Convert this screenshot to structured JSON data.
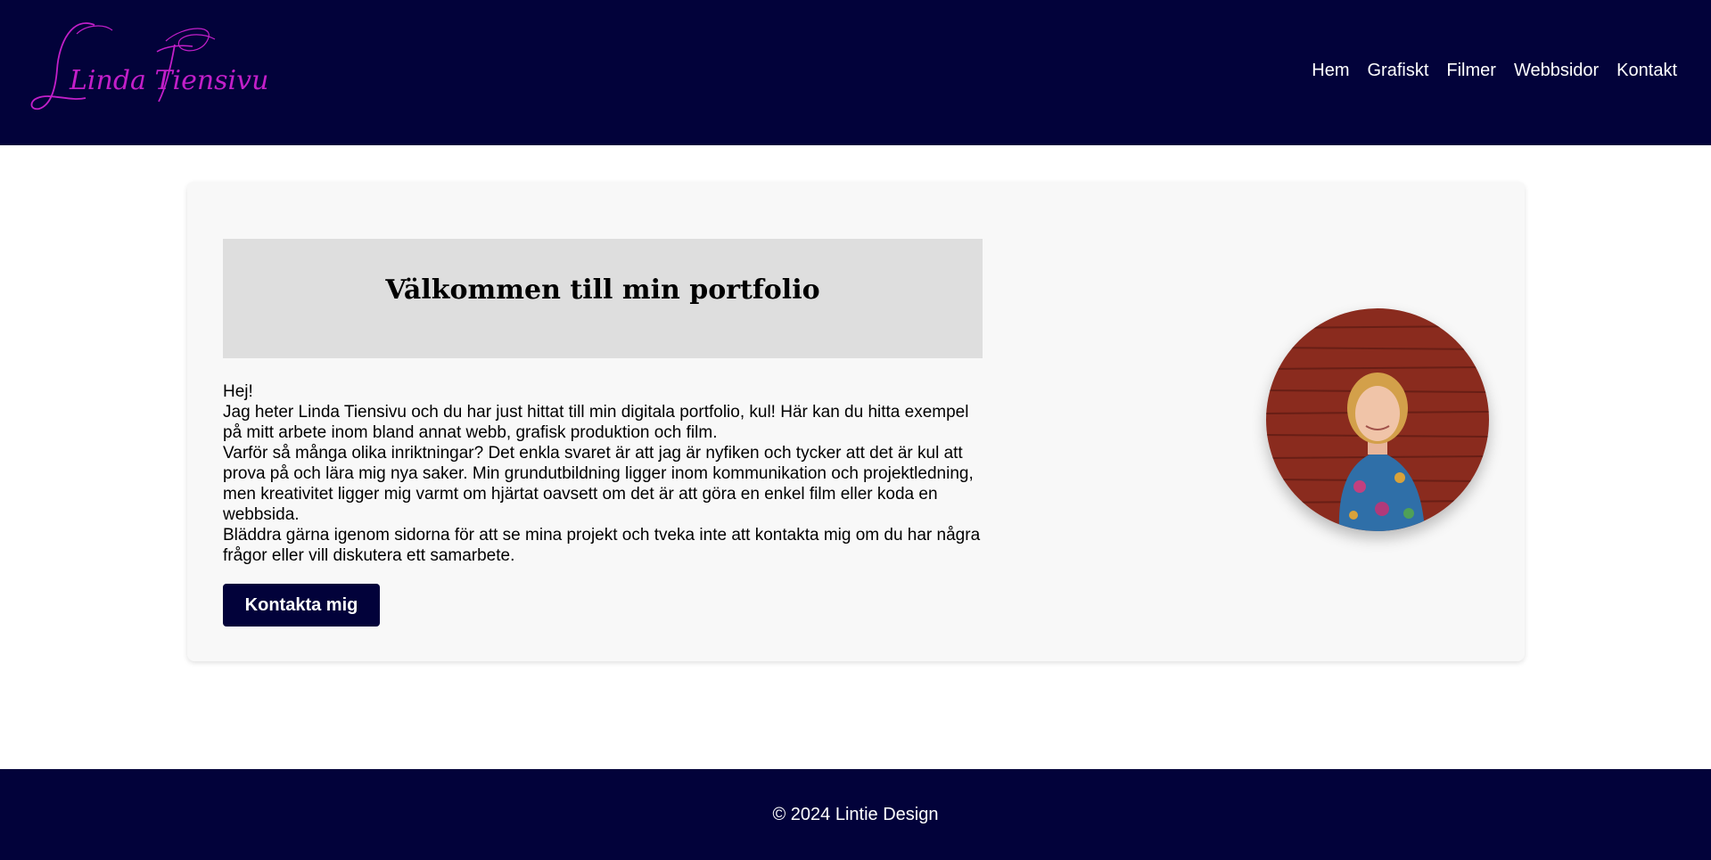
{
  "header": {
    "logo_text": "Linda Tiensivu",
    "nav": [
      {
        "label": "Hem"
      },
      {
        "label": "Grafiskt"
      },
      {
        "label": "Filmer"
      },
      {
        "label": "Webbsidor"
      },
      {
        "label": "Kontakt"
      }
    ]
  },
  "main": {
    "title": "Välkommen till min portfolio",
    "paragraphs": [
      "Hej!",
      "Jag heter Linda Tiensivu och du har just hittat till min digitala portfolio, kul! Här kan du hitta exempel på mitt arbete inom bland annat webb, grafisk produktion och film.",
      "Varför så många olika inriktningar? Det enkla svaret är att jag är nyfiken och tycker att det är kul att prova på och lära mig nya saker. Min grundutbildning ligger inom kommunikation och projektledning, men kreativitet ligger mig varmt om hjärtat oavsett om det är att göra en enkel film eller koda en webbsida.",
      "Bläddra gärna igenom sidorna för att se mina projekt och tveka inte att kontakta mig om du har några frågor eller vill diskutera ett samarbete."
    ],
    "cta_label": "Kontakta mig",
    "portrait_icon": "portrait-photo"
  },
  "footer": {
    "copyright": "© 2024 Lintie Design"
  },
  "colors": {
    "brand_navy": "#02023a",
    "logo_magenta": "#c21fc9",
    "card_bg": "#f8f8f8",
    "title_box_bg": "#dedede"
  }
}
